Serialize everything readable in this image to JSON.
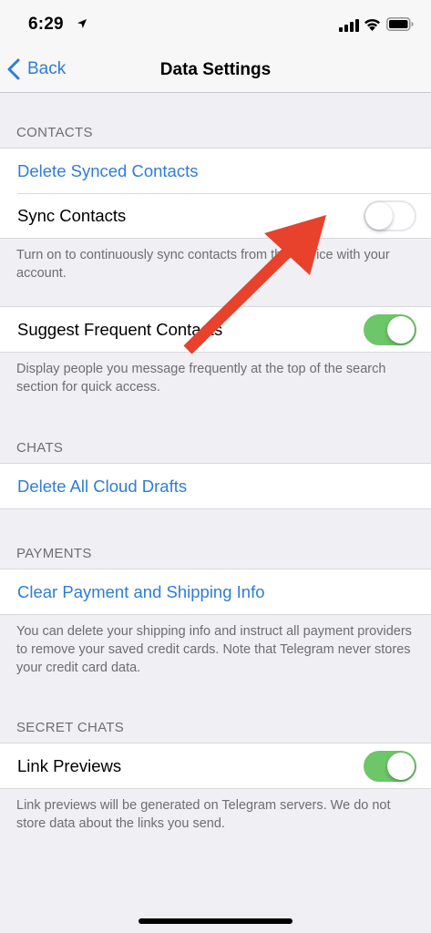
{
  "status_bar": {
    "time": "6:29"
  },
  "nav": {
    "back_label": "Back",
    "title": "Data Settings"
  },
  "contacts": {
    "header": "CONTACTS",
    "delete_synced": "Delete Synced Contacts",
    "sync_contacts": "Sync Contacts",
    "sync_enabled": false,
    "sync_footer": "Turn on to continuously sync contacts from this device with your account.",
    "suggest_frequent": "Suggest Frequent Contacts",
    "suggest_enabled": true,
    "suggest_footer": "Display people you message frequently at the top of the search section for quick access."
  },
  "chats": {
    "header": "CHATS",
    "delete_drafts": "Delete All Cloud Drafts"
  },
  "payments": {
    "header": "PAYMENTS",
    "clear_info": "Clear Payment and Shipping Info",
    "footer": "You can delete your shipping info and instruct all payment providers to remove your saved credit cards. Note that Telegram never stores your credit card data."
  },
  "secret_chats": {
    "header": "SECRET CHATS",
    "link_previews": "Link Previews",
    "link_previews_enabled": true,
    "footer": "Link previews will be generated on Telegram servers. We do not store data about the links you send."
  },
  "colors": {
    "accent": "#2f7dd6",
    "toggle_on": "#6dc667",
    "annotation_arrow": "#e8412c"
  },
  "icons": {
    "location": "location-arrow-icon",
    "signal": "cellular-signal-icon",
    "wifi": "wifi-icon",
    "battery": "battery-icon",
    "back": "chevron-left-icon"
  }
}
